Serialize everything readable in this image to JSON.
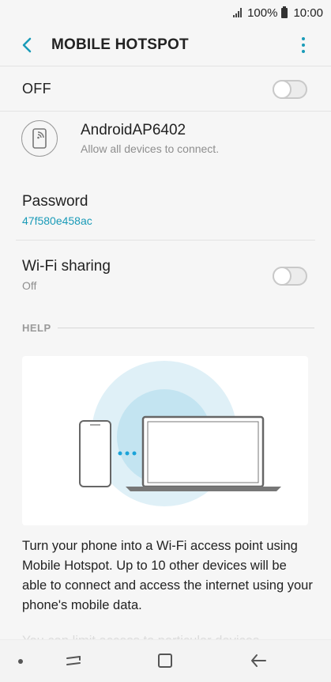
{
  "status_bar": {
    "battery_percent": "100%",
    "time": "10:00"
  },
  "app_bar": {
    "title": "MOBILE HOTSPOT",
    "back_icon": "chevron-left-icon",
    "more_icon": "more-vert-icon"
  },
  "master_switch": {
    "label": "OFF",
    "on": false
  },
  "network": {
    "name": "AndroidAP6402",
    "subtitle": "Allow all devices to connect.",
    "icon": "phone-hotspot-icon"
  },
  "password": {
    "label": "Password",
    "value": "47f580e458ac"
  },
  "wifi_sharing": {
    "label": "Wi-Fi sharing",
    "status": "Off",
    "on": false
  },
  "help": {
    "header": "HELP",
    "text": "Turn your phone into a Wi-Fi access point using Mobile Hotspot. Up to 10 other devices will be able to connect and access the internet using your phone's mobile data.",
    "text_partial": "You can limit access to particular devices..."
  },
  "nav_bar": {
    "items": [
      "recent-apps-icon",
      "home-icon",
      "back-icon"
    ]
  },
  "colors": {
    "accent": "#1a9bb8",
    "background": "#f6f6f6",
    "illustration_circle": "#dff0f7"
  }
}
